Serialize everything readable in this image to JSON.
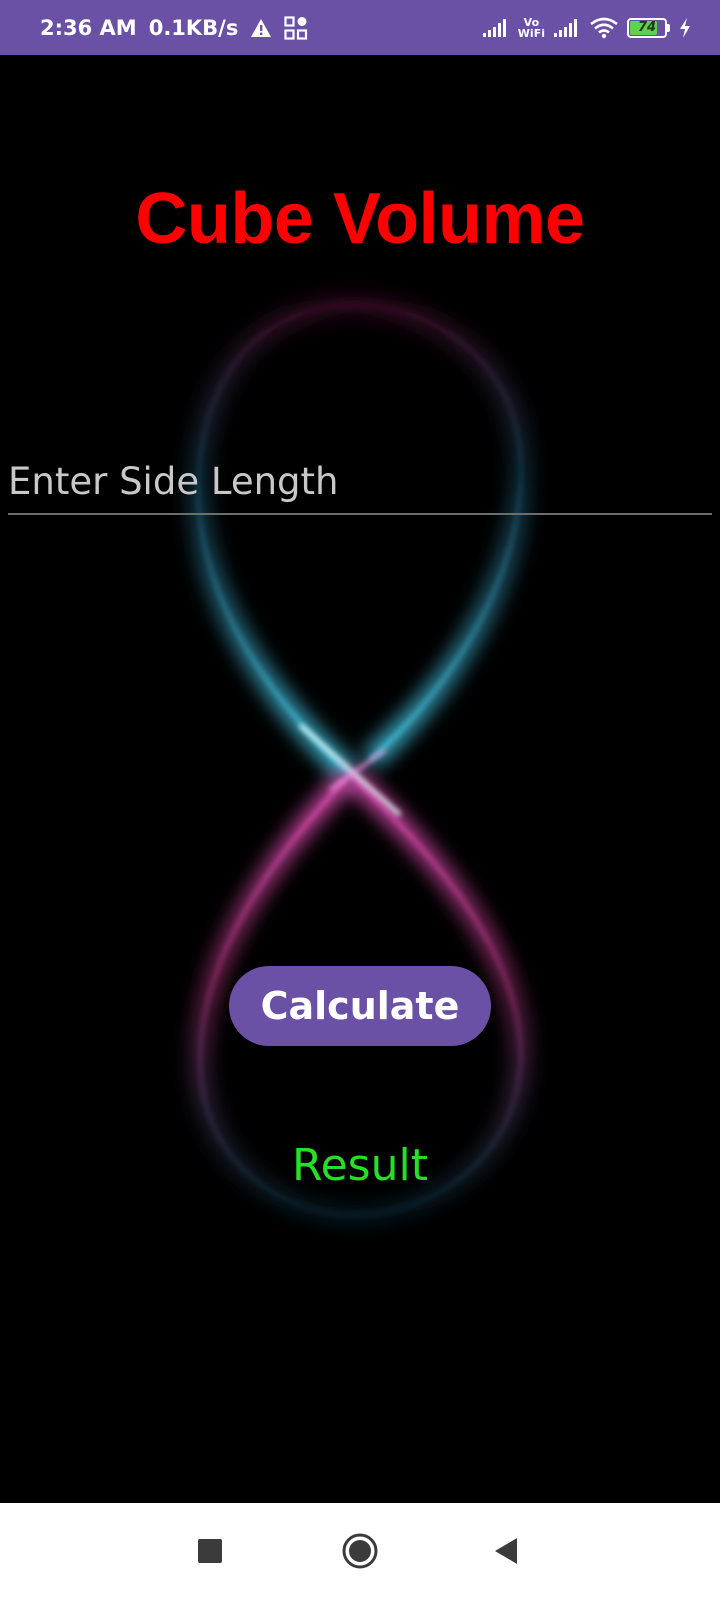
{
  "status_bar": {
    "time": "2:36 AM",
    "net_speed": "0.1KB/s",
    "vowifi_top": "Vo",
    "vowifi_bottom": "WiFi",
    "battery_level": "74",
    "icons": [
      "warning-icon",
      "apps-grid-icon",
      "signal-icon",
      "vowifi-icon",
      "wifi-icon",
      "battery-icon",
      "charging-icon"
    ]
  },
  "app": {
    "title": "Cube Volume",
    "input_placeholder": "Enter Side Length",
    "input_value": "",
    "button_label": "Calculate",
    "result_label": "Result"
  },
  "colors": {
    "status_bar": "#6a51a6",
    "title": "#ff0000",
    "button": "#6a51a6",
    "result": "#25e025",
    "background": "#000000"
  },
  "nav_bar": {
    "icons": [
      "recents-icon",
      "home-icon",
      "back-icon"
    ]
  }
}
